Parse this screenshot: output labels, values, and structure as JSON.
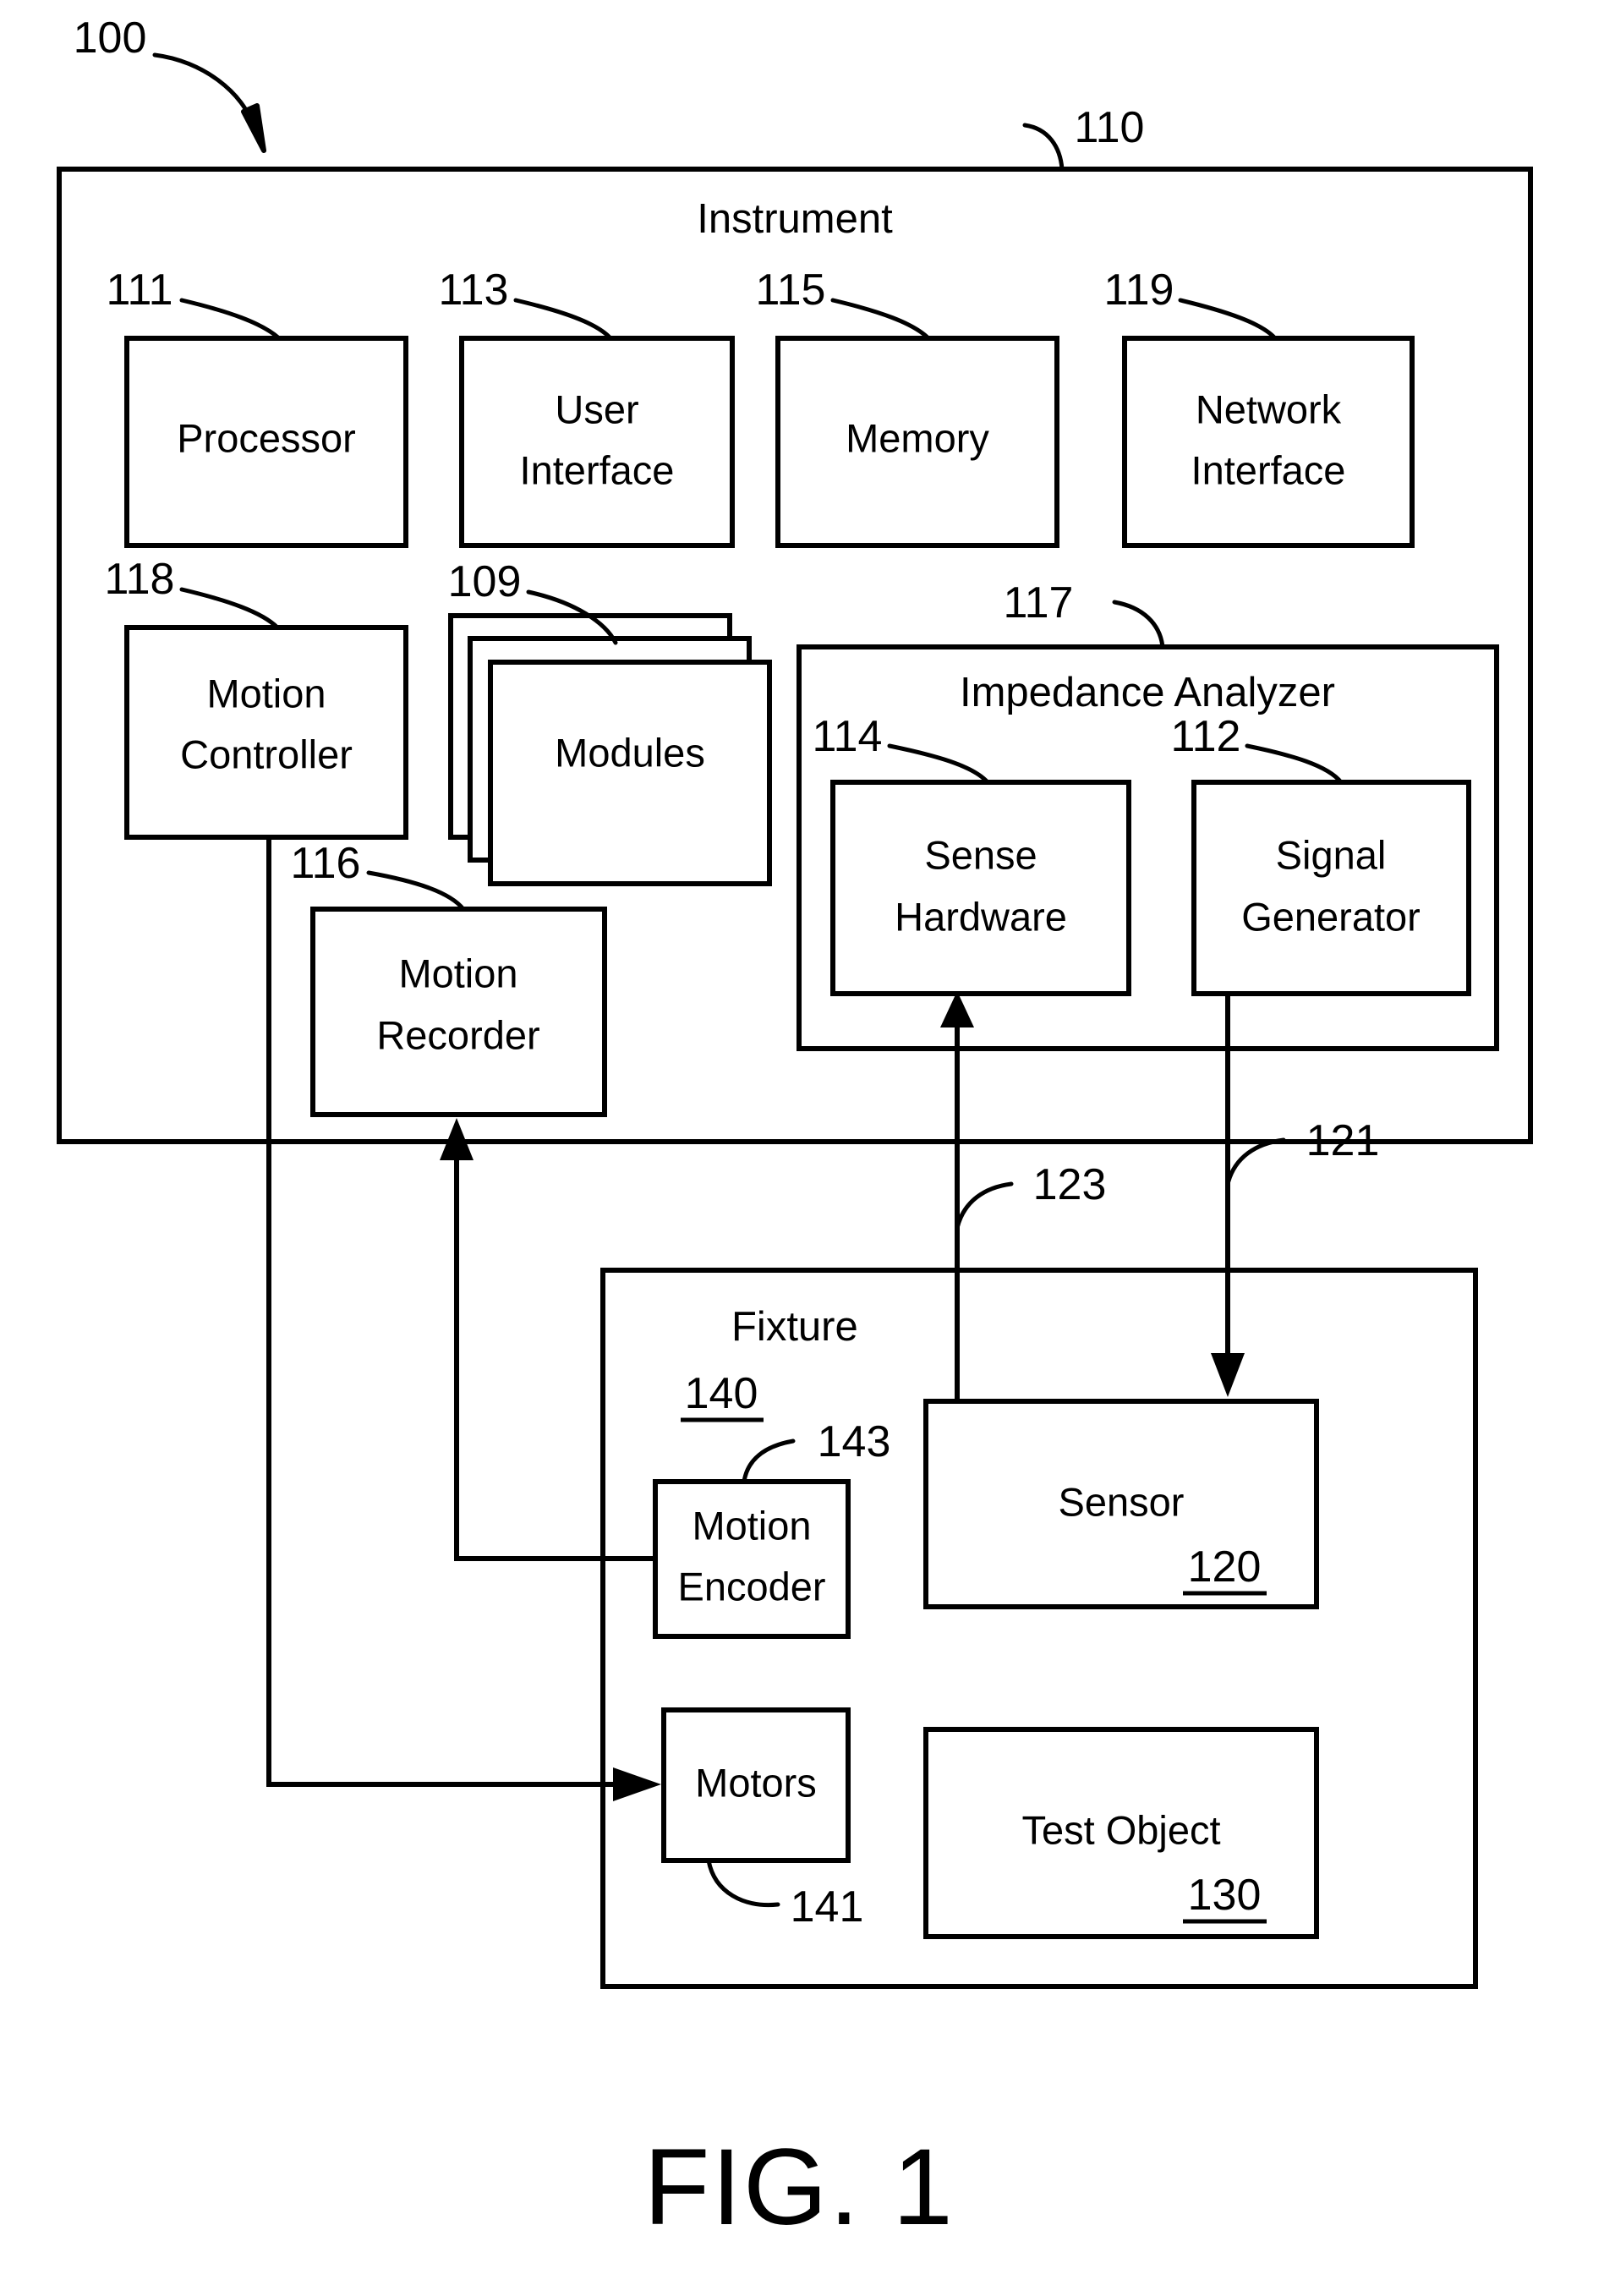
{
  "figure": {
    "caption": "FIG. 1",
    "system_ref": "100"
  },
  "instrument": {
    "title": "Instrument",
    "ref": "110",
    "components": [
      {
        "id": "processor",
        "label_line1": "Processor",
        "label_line2": "",
        "ref": "111"
      },
      {
        "id": "user-interface",
        "label_line1": "User",
        "label_line2": "Interface",
        "ref": "113"
      },
      {
        "id": "memory",
        "label_line1": "Memory",
        "label_line2": "",
        "ref": "115"
      },
      {
        "id": "network-interface",
        "label_line1": "Network",
        "label_line2": "Interface",
        "ref": "119"
      },
      {
        "id": "motion-controller",
        "label_line1": "Motion",
        "label_line2": "Controller",
        "ref": "118"
      },
      {
        "id": "modules",
        "label_line1": "Modules",
        "label_line2": "",
        "ref": "109"
      },
      {
        "id": "motion-recorder",
        "label_line1": "Motion",
        "label_line2": "Recorder",
        "ref": "116"
      }
    ]
  },
  "impedance_analyzer": {
    "title": "Impedance Analyzer",
    "ref": "117",
    "components": [
      {
        "id": "sense-hardware",
        "label_line1": "Sense",
        "label_line2": "Hardware",
        "ref": "114"
      },
      {
        "id": "signal-generator",
        "label_line1": "Signal",
        "label_line2": "Generator",
        "ref": "112"
      }
    ]
  },
  "fixture": {
    "title": "Fixture",
    "ref": "140",
    "components": [
      {
        "id": "motion-encoder",
        "label_line1": "Motion",
        "label_line2": "Encoder",
        "ref": "143"
      },
      {
        "id": "motors",
        "label_line1": "Motors",
        "label_line2": "",
        "ref": "141"
      },
      {
        "id": "sensor",
        "label_line1": "Sensor",
        "label_line2": "",
        "ref": "120"
      },
      {
        "id": "test-object",
        "label_line1": "Test Object",
        "label_line2": "",
        "ref": "130"
      }
    ]
  },
  "connections": [
    {
      "id": "sense-to-sensor",
      "ref": "123",
      "from": "sensor",
      "to": "sense-hardware"
    },
    {
      "id": "signalgen-to-sensor",
      "ref": "121",
      "from": "signal-generator",
      "to": "sensor"
    },
    {
      "id": "encoder-to-recorder",
      "ref": "",
      "from": "motion-encoder",
      "to": "motion-recorder"
    },
    {
      "id": "controller-to-motors",
      "ref": "",
      "from": "motion-controller",
      "to": "motors"
    }
  ]
}
